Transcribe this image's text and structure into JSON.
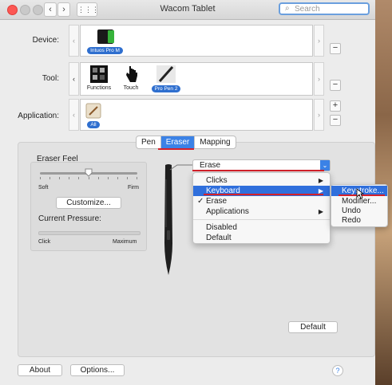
{
  "window": {
    "title": "Wacom Tablet"
  },
  "search": {
    "placeholder": "Search"
  },
  "labels": {
    "device": "Device:",
    "tool": "Tool:",
    "application": "Application:"
  },
  "device": {
    "name": "Intuos Pro M"
  },
  "tools": [
    {
      "name": "Functions"
    },
    {
      "name": "Touch"
    },
    {
      "name": "Pro Pen 2"
    }
  ],
  "application": {
    "name": "All"
  },
  "tabs": [
    {
      "label": "Pen"
    },
    {
      "label": "Eraser"
    },
    {
      "label": "Mapping"
    }
  ],
  "eraser_feel": {
    "title": "Eraser Feel",
    "soft": "Soft",
    "firm": "Firm",
    "customize": "Customize...",
    "pressure_title": "Current Pressure:",
    "click": "Click",
    "maximum": "Maximum",
    "feel_level": 0.5
  },
  "eraser_action": {
    "value": "Erase"
  },
  "menu": {
    "items": [
      {
        "label": "Clicks",
        "submenu": true
      },
      {
        "label": "Keyboard",
        "submenu": true,
        "highlighted": true
      },
      {
        "label": "Erase",
        "checked": true
      },
      {
        "label": "Applications",
        "submenu": true
      },
      {
        "label": "Disabled"
      },
      {
        "label": "Default"
      }
    ]
  },
  "submenu": {
    "items": [
      {
        "label": "Keystroke...",
        "highlighted": true
      },
      {
        "label": "Modifier..."
      },
      {
        "label": "Undo"
      },
      {
        "label": "Redo"
      }
    ]
  },
  "buttons": {
    "default": "Default",
    "about": "About",
    "options": "Options...",
    "help": "?"
  },
  "colors": {
    "accent": "#2f6fdc",
    "annotation_red": "#d4202a"
  },
  "icons": [
    "search-icon",
    "back-chevron-icon",
    "forward-chevron-icon",
    "grid-icon"
  ]
}
